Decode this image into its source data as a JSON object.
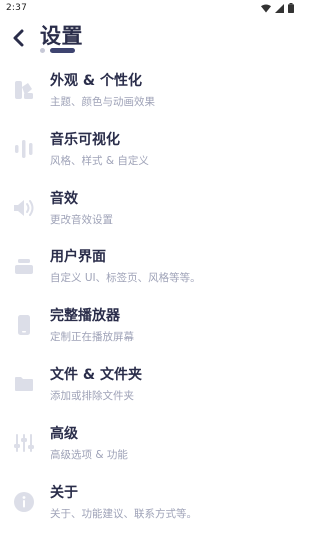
{
  "status_bar": {
    "time": "2:37",
    "icons": [
      "wifi-icon",
      "signal-icon",
      "battery-icon"
    ]
  },
  "header": {
    "title": "设置",
    "back_icon": "back-arrow-icon"
  },
  "colors": {
    "primary_text": "#2a2d4a",
    "secondary_text": "#9fa3b8",
    "icon": "#dcdee8",
    "indicator_active": "#3e4470",
    "indicator_inactive": "#c6c8d6"
  },
  "settings": {
    "items": [
      {
        "icon": "palette-icon",
        "title": "外观 & 个性化",
        "subtitle": "主题、颜色与动画效果"
      },
      {
        "icon": "visualizer-icon",
        "title": "音乐可视化",
        "subtitle": "风格、样式 & 自定义"
      },
      {
        "icon": "speaker-icon",
        "title": "音效",
        "subtitle": "更改音效设置"
      },
      {
        "icon": "layers-icon",
        "title": "用户界面",
        "subtitle": "自定义 UI、标签页、风格等等。"
      },
      {
        "icon": "phone-icon",
        "title": "完整播放器",
        "subtitle": "定制正在播放屏幕"
      },
      {
        "icon": "folder-icon",
        "title": "文件 & 文件夹",
        "subtitle": "添加或排除文件夹"
      },
      {
        "icon": "sliders-icon",
        "title": "高级",
        "subtitle": "高级选项 & 功能"
      },
      {
        "icon": "info-icon",
        "title": "关于",
        "subtitle": "关于、功能建议、联系方式等。"
      }
    ]
  }
}
